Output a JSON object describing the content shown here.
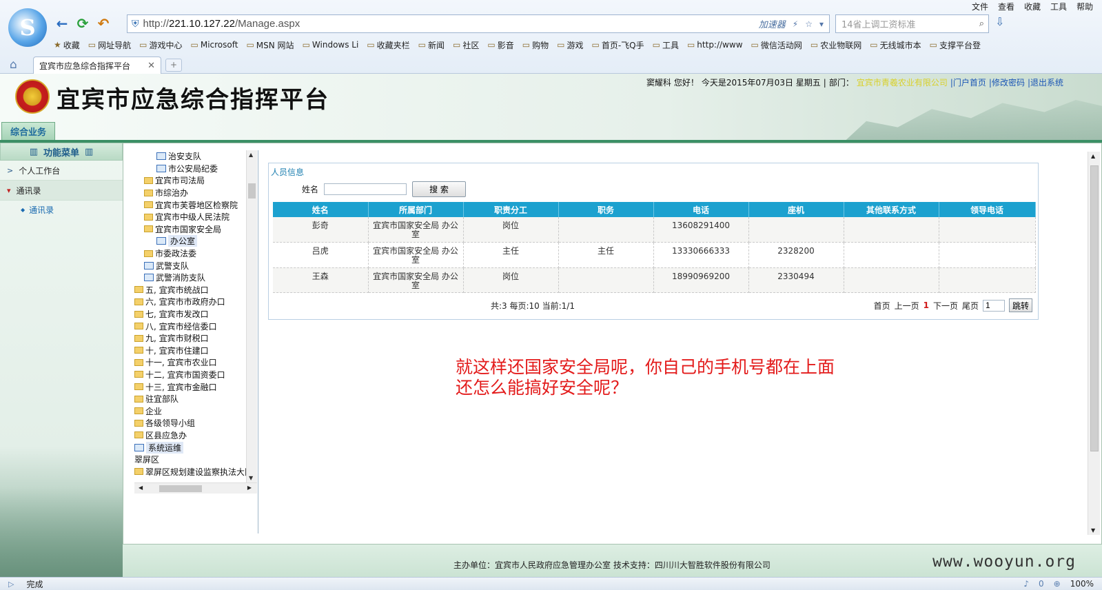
{
  "browser": {
    "address": {
      "prefix": "http://",
      "host": "221.10.127.22",
      "path": "/Manage.aspx"
    },
    "accelerator": "加速器",
    "search_placeholder": "14省上调工资标准",
    "menu": [
      "文件",
      "查看",
      "收藏",
      "工具",
      "帮助"
    ],
    "bookmarks": [
      "收藏",
      "网址导航",
      "游戏中心",
      "Microsoft",
      "MSN 网站",
      "Windows Li",
      "收藏夹栏",
      "新闻",
      "社区",
      "影音",
      "购物",
      "游戏",
      "首页-飞Q手",
      "工具",
      "http://www",
      "微信活动网",
      "农业物联网",
      "无线城市本",
      "支撑平台登"
    ],
    "tab_title": "宜宾市应急综合指挥平台",
    "status_text": "完成",
    "zoom": "100%",
    "status_count": "0"
  },
  "site": {
    "title": "宜宾市应急综合指挥平台",
    "user": "窦耀科",
    "greeting": "您好！",
    "date_text": "今天是2015年07月03日 星期五",
    "dept_label": "部门：",
    "dept": "宜宾市青羲农业有限公司",
    "links": [
      "|门户首页",
      "|修改密码",
      "|退出系统"
    ],
    "main_tab": "综合业务"
  },
  "menu": {
    "header": "功能菜单",
    "items": [
      {
        "label": "个人工作台",
        "open": false
      },
      {
        "label": "通讯录",
        "open": true
      }
    ],
    "sub": "通讯录"
  },
  "tree": [
    {
      "label": "治安支队",
      "icon": "page",
      "indent": 32
    },
    {
      "label": "市公安局纪委",
      "icon": "page",
      "indent": 32
    },
    {
      "label": "宜宾市司法局",
      "icon": "folder",
      "indent": 14
    },
    {
      "label": "市综治办",
      "icon": "folder",
      "indent": 14
    },
    {
      "label": "宜宾市芙蓉地区检察院",
      "icon": "folder",
      "indent": 14
    },
    {
      "label": "宜宾市中级人民法院",
      "icon": "folder",
      "indent": 14
    },
    {
      "label": "宜宾市国家安全局",
      "icon": "folder",
      "indent": 14
    },
    {
      "label": "办公室",
      "icon": "page",
      "indent": 32,
      "selected": true
    },
    {
      "label": "市委政法委",
      "icon": "folder",
      "indent": 14
    },
    {
      "label": "武警支队",
      "icon": "page",
      "indent": 14
    },
    {
      "label": "武警消防支队",
      "icon": "page",
      "indent": 14
    },
    {
      "label": "五, 宜宾市统战口",
      "icon": "folder",
      "indent": 0
    },
    {
      "label": "六, 宜宾市市政府办口",
      "icon": "folder",
      "indent": 0
    },
    {
      "label": "七, 宜宾市发改口",
      "icon": "folder",
      "indent": 0
    },
    {
      "label": "八, 宜宾市经信委口",
      "icon": "folder",
      "indent": 0
    },
    {
      "label": "九, 宜宾市财税口",
      "icon": "folder",
      "indent": 0
    },
    {
      "label": "十, 宜宾市住建口",
      "icon": "folder",
      "indent": 0
    },
    {
      "label": "十一, 宜宾市农业口",
      "icon": "folder",
      "indent": 0
    },
    {
      "label": "十二, 宜宾市国资委口",
      "icon": "folder",
      "indent": 0
    },
    {
      "label": "十三, 宜宾市金融口",
      "icon": "folder",
      "indent": 0
    },
    {
      "label": "驻宜部队",
      "icon": "folder",
      "indent": 0
    },
    {
      "label": "企业",
      "icon": "folder",
      "indent": 0
    },
    {
      "label": "各级领导小组",
      "icon": "folder",
      "indent": 0
    },
    {
      "label": "区县应急办",
      "icon": "folder",
      "indent": 0
    },
    {
      "label": "系统运维",
      "icon": "page",
      "indent": 0,
      "selected": true
    },
    {
      "label": "翠屏区",
      "icon": "none",
      "indent": 0
    },
    {
      "label": "翠屏区规划建设监察执法大队",
      "icon": "folder",
      "indent": 0
    }
  ],
  "panel": {
    "title": "人员信息",
    "name_label": "姓名",
    "name_value": "",
    "search_button": "搜 索",
    "columns": [
      "姓名",
      "所属部门",
      "职责分工",
      "职务",
      "电话",
      "座机",
      "其他联系方式",
      "领导电话"
    ],
    "rows": [
      [
        "彭奇",
        "宜宾市国家安全局 办公室",
        "岗位",
        "",
        "13608291400",
        "",
        "",
        ""
      ],
      [
        "吕虎",
        "宜宾市国家安全局 办公室",
        "主任",
        "主任",
        "13330666333",
        "2328200",
        "",
        ""
      ],
      [
        "王森",
        "宜宾市国家安全局 办公室",
        "岗位",
        "",
        "18990969200",
        "2330494",
        "",
        ""
      ]
    ],
    "pager_info": "共:3  每页:10  当前:1/1",
    "pager": {
      "first": "首页",
      "prev": "上一页",
      "current": "1",
      "next": "下一页",
      "last": "尾页",
      "input": "1",
      "jump": "跳转"
    }
  },
  "annotation": [
    "就这样还国家安全局呢，你自己的手机号都在上面",
    "还怎么能搞好安全呢？"
  ],
  "footer": {
    "text": "主办单位：宜宾市人民政府应急管理办公室 技术支持：四川川大智胜软件股份有限公司",
    "watermark": "www.wooyun.org"
  }
}
